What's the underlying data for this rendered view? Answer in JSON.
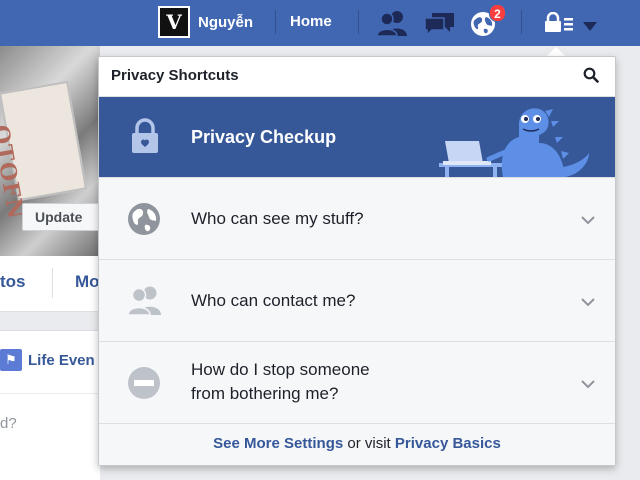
{
  "topbar": {
    "profile_initial": "V",
    "profile_name": "Nguyễn",
    "home_label": "Home",
    "notification_count": "2",
    "icons": [
      "friends-icon",
      "messages-icon",
      "notifications-globe-icon",
      "privacy-lock-icon",
      "menu-caret-icon"
    ]
  },
  "background": {
    "cover_text": "OTOFN",
    "update_label": "Update",
    "tab_photos_partial": "tos",
    "tab_more_partial": "Mo",
    "life_event_label": "Life Even",
    "composer_prompt_partial": "d?"
  },
  "panel": {
    "title": "Privacy Shortcuts",
    "checkup_label": "Privacy Checkup",
    "items": [
      {
        "label": "Who can see my stuff?",
        "icon": "globe-icon"
      },
      {
        "label": "Who can contact me?",
        "icon": "people-icon"
      },
      {
        "label_line1": "How do I stop someone",
        "label_line2": "from bothering me?",
        "icon": "block-icon"
      }
    ],
    "footer": {
      "see_more": "See More Settings",
      "or_visit": " or visit ",
      "privacy_basics": "Privacy Basics"
    }
  },
  "colors": {
    "brand_blue": "#4267b2",
    "checkup_blue": "#365899",
    "link_blue": "#365899",
    "badge_red": "#fa3e3e",
    "dino_blue": "#5e8fe6"
  }
}
